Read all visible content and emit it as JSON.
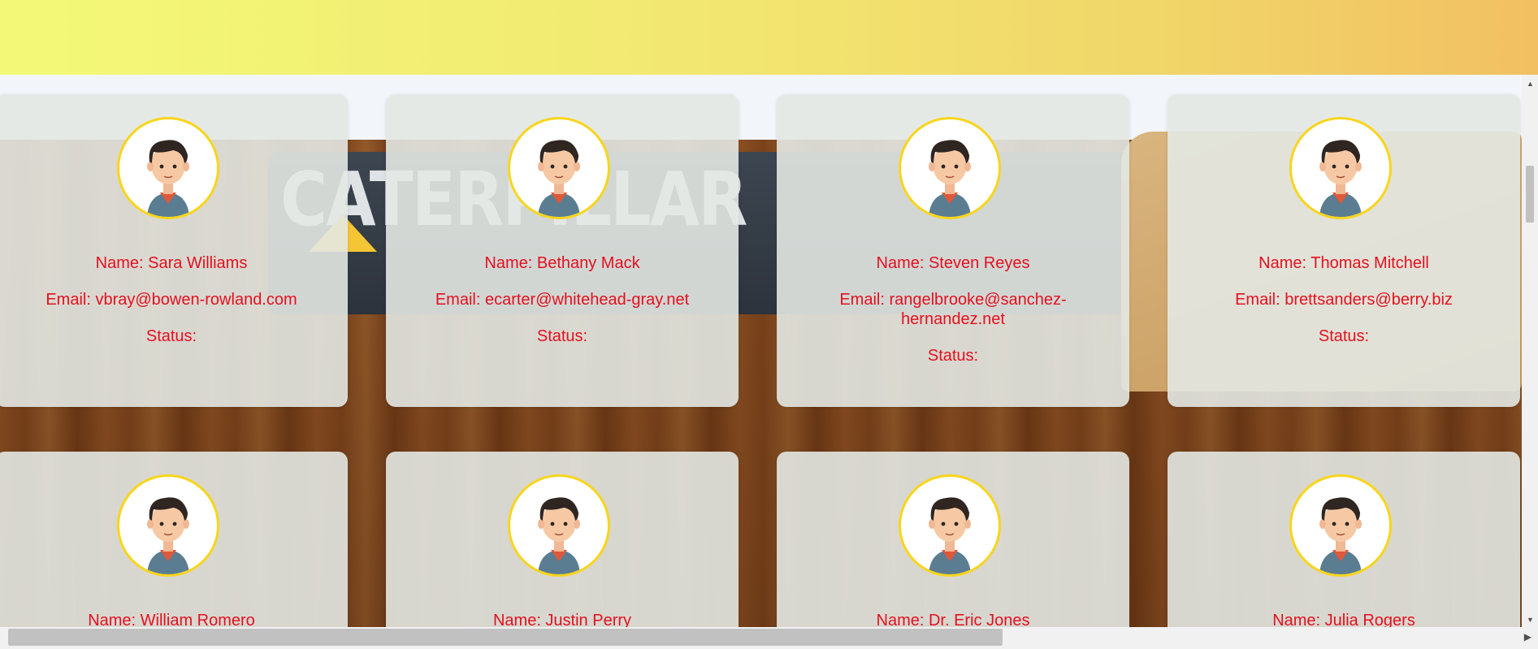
{
  "users": [
    {
      "name": "Name: Sara Williams",
      "email": "Email: vbray@bowen-rowland.com",
      "status": "Status:"
    },
    {
      "name": "Name: Bethany Mack",
      "email": "Email: ecarter@whitehead-gray.net",
      "status": "Status:"
    },
    {
      "name": "Name: Steven Reyes",
      "email": "Email: rangelbrooke@sanchez-hernandez.net",
      "status": "Status:"
    },
    {
      "name": "Name: Thomas Mitchell",
      "email": "Email: brettsanders@berry.biz",
      "status": "Status:"
    },
    {
      "name": "Name: William Romero"
    },
    {
      "name": "Name: Justin Perry"
    },
    {
      "name": "Name: Dr. Eric Jones"
    },
    {
      "name": "Name: Julia Rogers"
    }
  ],
  "background": {
    "brand_text": "CATERPILLAR"
  },
  "colors": {
    "text": "#e4101f",
    "avatar_border": "#f8d51c",
    "banner_start": "#f3f977",
    "banner_end": "#f2c062"
  },
  "icons": {
    "avatar": "man-avatar-icon",
    "scroll_up": "up-arrow-icon",
    "scroll_down": "down-arrow-icon",
    "scroll_right": "right-arrow-icon"
  }
}
